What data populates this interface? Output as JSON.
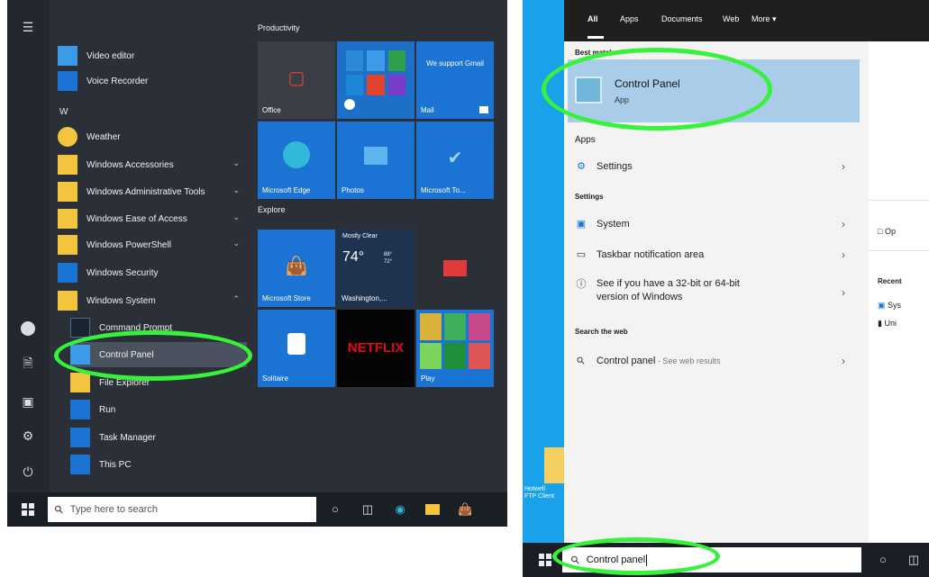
{
  "start_menu": {
    "rail_icons": [
      "hamburger-icon",
      "user-avatar-icon",
      "documents-icon",
      "pictures-icon",
      "settings-icon",
      "power-icon"
    ],
    "apps": [
      {
        "type": "item",
        "label": "Video editor",
        "icon": "video-editor-icon"
      },
      {
        "type": "item",
        "label": "Voice Recorder",
        "icon": "voice-recorder-icon"
      },
      {
        "type": "letter",
        "label": "W"
      },
      {
        "type": "item",
        "label": "Weather",
        "icon": "weather-icon"
      },
      {
        "type": "item",
        "label": "Windows Accessories",
        "icon": "folder-icon",
        "expandable": true
      },
      {
        "type": "item",
        "label": "Windows Administrative Tools",
        "icon": "folder-icon",
        "expandable": true
      },
      {
        "type": "item",
        "label": "Windows Ease of Access",
        "icon": "folder-icon",
        "expandable": true
      },
      {
        "type": "item",
        "label": "Windows PowerShell",
        "icon": "folder-icon",
        "expandable": true
      },
      {
        "type": "item",
        "label": "Windows Security",
        "icon": "shield-icon"
      },
      {
        "type": "item",
        "label": "Windows System",
        "icon": "folder-icon",
        "expandable": true,
        "expanded": true
      },
      {
        "type": "subitem",
        "label": "Command Prompt",
        "icon": "command-prompt-icon"
      },
      {
        "type": "subitem",
        "label": "Control Panel",
        "icon": "control-panel-icon",
        "selected": true
      },
      {
        "type": "subitem",
        "label": "File Explorer",
        "icon": "file-explorer-icon"
      },
      {
        "type": "subitem",
        "label": "Run",
        "icon": "run-icon"
      },
      {
        "type": "subitem",
        "label": "Task Manager",
        "icon": "task-manager-icon"
      },
      {
        "type": "subitem",
        "label": "This PC",
        "icon": "this-pc-icon"
      }
    ],
    "groups": {
      "productivity": "Productivity",
      "explore": "Explore"
    },
    "tiles": {
      "office": "Office",
      "mail": "Mail",
      "mail_promo": "We support Gmail",
      "edge": "Microsoft Edge",
      "photos": "Photos",
      "todo": "Microsoft To...",
      "store": "Microsoft Store",
      "weather_condition": "Mostly Clear",
      "weather_temp": "74°",
      "weather_hi": "88°",
      "weather_lo": "72°",
      "weather_city": "Washington,...",
      "solitaire": "Solitaire",
      "netflix": "NETFLIX",
      "play": "Play"
    },
    "taskbar": {
      "search_placeholder": "Type here to search"
    }
  },
  "search_panel": {
    "scopes": [
      "All",
      "Apps",
      "Documents",
      "Web",
      "More"
    ],
    "more_arrow": "▾",
    "best_match_heading": "Best match",
    "best_match": {
      "title": "Control Panel",
      "subtitle": "App"
    },
    "apps_heading": "Apps",
    "apps": [
      {
        "label": "Settings",
        "icon": "settings-icon"
      }
    ],
    "settings_heading": "Settings",
    "settings": [
      {
        "label": "System",
        "icon": "monitor-icon"
      },
      {
        "label": "Taskbar notification area",
        "icon": "taskbar-icon"
      },
      {
        "label": "See if you have a 32-bit or 64-bit",
        "label2": "version of Windows",
        "icon": "info-icon"
      }
    ],
    "web_heading": "Search the web",
    "web": [
      {
        "label": "Control panel",
        "suffix": " - See web results",
        "icon": "search-icon"
      }
    ],
    "preview": {
      "open": "Op",
      "recent": "Recent",
      "recent_items": [
        "Sys",
        "Uni"
      ]
    },
    "desktop_label": "Hotwell\nFTP Client",
    "taskbar": {
      "search_value": "Control panel"
    }
  },
  "colors": {
    "highlight": "#36f23a",
    "start_bg": "#2b3038",
    "accent": "#1b73d3",
    "best_match_bg": "#a9cde8"
  }
}
